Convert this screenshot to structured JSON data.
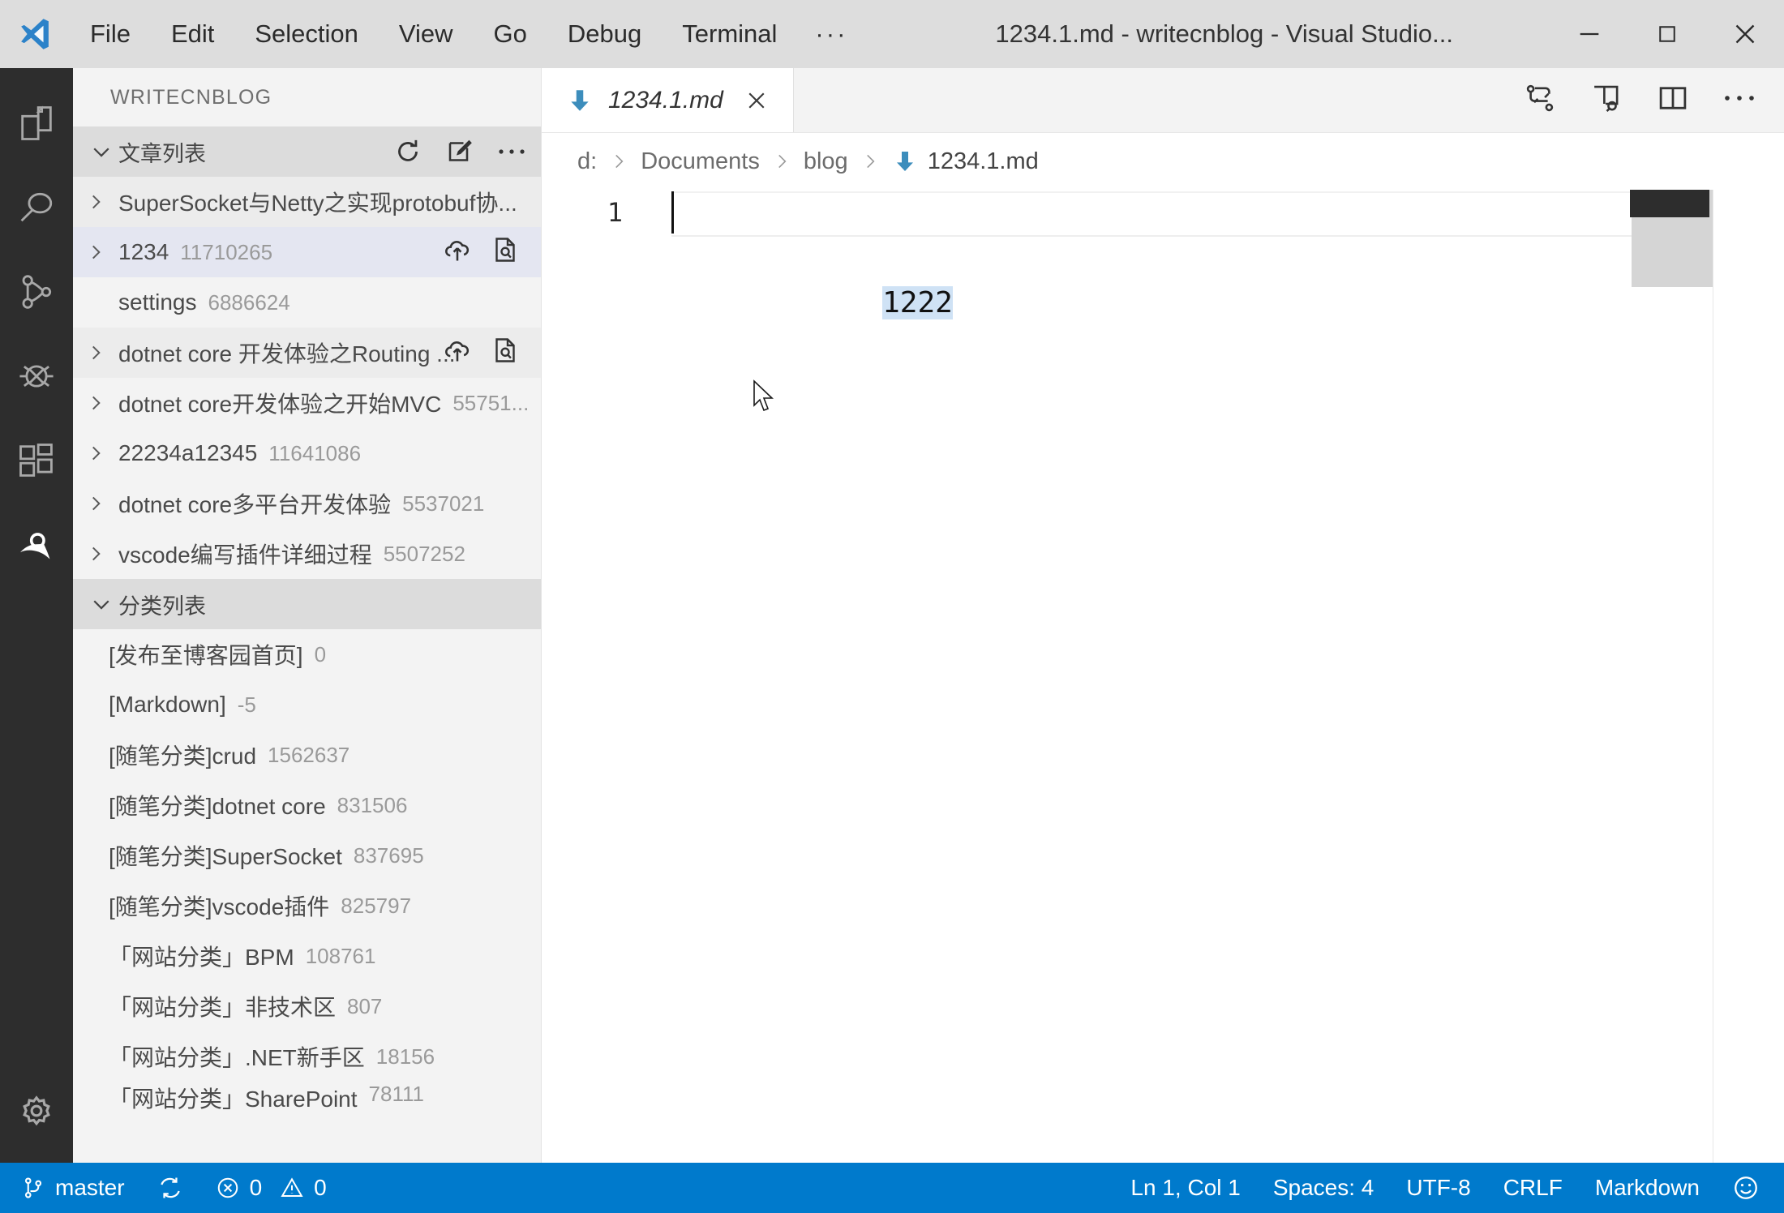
{
  "titlebar": {
    "logo_icon": "vscode-logo-icon",
    "menus": [
      "File",
      "Edit",
      "Selection",
      "View",
      "Go",
      "Debug",
      "Terminal"
    ],
    "overflow_label": "···",
    "window_title": "1234.1.md - writecnblog - Visual Studio...",
    "minimize_label": "minimize-icon",
    "maximize_label": "maximize-icon",
    "close_label": "close-icon"
  },
  "activitybar": {
    "items": [
      {
        "icon": "explorer-files-icon",
        "active": false
      },
      {
        "icon": "search-icon",
        "active": false
      },
      {
        "icon": "source-control-icon",
        "active": false
      },
      {
        "icon": "debug-icon",
        "active": false
      },
      {
        "icon": "extensions-icon",
        "active": false
      },
      {
        "icon": "writecnblog-icon",
        "active": true
      }
    ],
    "settings_icon": "gear-icon"
  },
  "sidebar": {
    "title": "WRITECNBLOG",
    "articles_section": {
      "label": "文章列表",
      "collapsed": false,
      "chevron_icon": "chevron-down-icon",
      "actions": [
        {
          "name": "refresh-button",
          "icon": "refresh-icon"
        },
        {
          "name": "new-article-button",
          "icon": "edit-pencil-icon"
        },
        {
          "name": "more-actions-button",
          "icon": "more-horizontal-icon"
        }
      ],
      "items": [
        {
          "label": "SuperSocket与Netty之实现protobuf协...",
          "count": "",
          "expandable": true,
          "state": "hovered",
          "actions": false
        },
        {
          "label": "1234",
          "count": "11710265",
          "expandable": true,
          "state": "selected",
          "actions": true
        },
        {
          "label": "settings",
          "count": "6886624",
          "expandable": false,
          "state": "none",
          "actions": false
        },
        {
          "label": "dotnet core 开发体验之Routing ...",
          "count": "",
          "expandable": true,
          "state": "hovered",
          "actions": true
        },
        {
          "label": "dotnet core开发体验之开始MVC",
          "count": "55751...",
          "expandable": true,
          "state": "none",
          "actions": false
        },
        {
          "label": "22234a12345",
          "count": "11641086",
          "expandable": true,
          "state": "none",
          "actions": false
        },
        {
          "label": "dotnet core多平台开发体验",
          "count": "5537021",
          "expandable": true,
          "state": "none",
          "actions": false
        },
        {
          "label": "vscode编写插件详细过程",
          "count": "5507252",
          "expandable": true,
          "state": "none",
          "actions": false
        }
      ],
      "row_action_icons": [
        {
          "name": "upload-article-button",
          "icon": "cloud-upload-icon"
        },
        {
          "name": "preview-article-button",
          "icon": "document-search-icon"
        }
      ]
    },
    "categories_section": {
      "label": "分类列表",
      "collapsed": false,
      "chevron_icon": "chevron-down-icon",
      "items": [
        {
          "label": "[发布至博客园首页]",
          "count": "0"
        },
        {
          "label": "[Markdown]",
          "count": "-5"
        },
        {
          "label": "[随笔分类]crud",
          "count": "1562637"
        },
        {
          "label": "[随笔分类]dotnet core",
          "count": "831506"
        },
        {
          "label": "[随笔分类]SuperSocket",
          "count": "837695"
        },
        {
          "label": "[随笔分类]vscode插件",
          "count": "825797"
        },
        {
          "label": "「网站分类」BPM",
          "count": "108761"
        },
        {
          "label": "「网站分类」非技术区",
          "count": "807"
        },
        {
          "label": "「网站分类」.NET新手区",
          "count": "18156"
        },
        {
          "label": "「网站分类」SharePoint",
          "count": "78111"
        }
      ]
    }
  },
  "editor": {
    "tab": {
      "filename": "1234.1.md",
      "file_icon": "markdown-down-arrow-icon",
      "close_icon": "close-icon",
      "active": true
    },
    "actions": [
      {
        "name": "compare-changes-button",
        "icon": "compare-changes-icon"
      },
      {
        "name": "open-preview-to-side-button",
        "icon": "open-preview-side-icon"
      },
      {
        "name": "split-editor-button",
        "icon": "split-editor-icon"
      },
      {
        "name": "more-editor-actions-button",
        "icon": "more-horizontal-icon"
      }
    ],
    "breadcrumb": [
      {
        "label": "d:",
        "icon": ""
      },
      {
        "label": "Documents",
        "icon": ""
      },
      {
        "label": "blog",
        "icon": ""
      },
      {
        "label": "1234.1.md",
        "icon": "markdown-down-arrow-icon"
      }
    ],
    "breadcrumb_separator": "chevron-right-icon",
    "lines": [
      {
        "number": "1",
        "text": "1222",
        "selected": true
      }
    ]
  },
  "statusbar": {
    "left": [
      {
        "name": "branch-status",
        "icon": "source-control-branch-icon",
        "label": "master"
      },
      {
        "name": "sync-status",
        "icon": "sync-icon",
        "label": ""
      },
      {
        "name": "problems-status",
        "icon": "error-warning-icons",
        "errors": "0",
        "warnings": "0"
      }
    ],
    "right": [
      {
        "name": "cursor-position-status",
        "label": "Ln 1, Col 1"
      },
      {
        "name": "indentation-status",
        "label": "Spaces: 4"
      },
      {
        "name": "encoding-status",
        "label": "UTF-8"
      },
      {
        "name": "eol-status",
        "label": "CRLF"
      },
      {
        "name": "language-mode-status",
        "label": "Markdown"
      },
      {
        "name": "feedback-status",
        "icon": "smiley-icon",
        "label": ""
      }
    ]
  },
  "colors": {
    "titlebar_bg": "#dddddd",
    "activitybar_bg": "#2d2d2d",
    "sidebar_bg": "#f3f3f3",
    "section_header_bg": "#dcdcdc",
    "selected_row_bg": "#e4e6f1",
    "statusbar_bg": "#007acc",
    "selection_bg": "#cfe2f5",
    "accent_blue": "#3c8dbc"
  }
}
